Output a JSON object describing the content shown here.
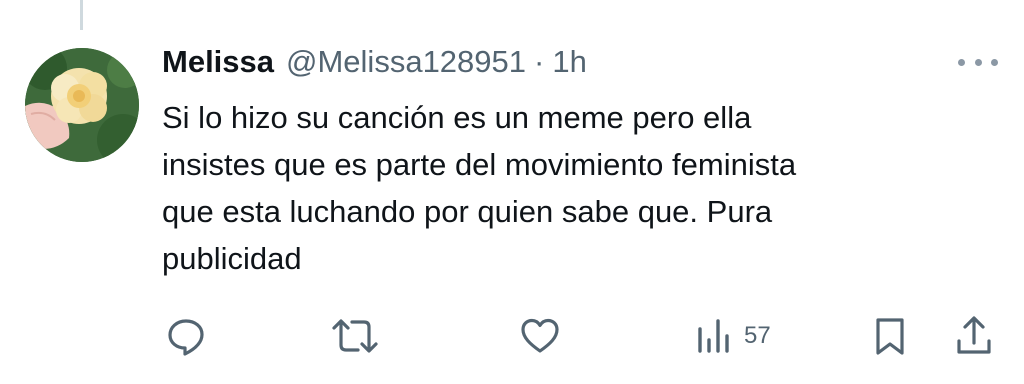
{
  "tweet": {
    "display_name": "Melissa",
    "handle": "@Melissa128951",
    "separator": "·",
    "time": "1h",
    "text_lines": [
      "Si lo hizo su canción es un meme pero ella",
      "insistes que es parte del movimiento feminista",
      "que esta luchando por quien sabe que. Pura",
      "publicidad"
    ]
  },
  "actions": {
    "reply_icon": "reply-icon",
    "retweet_icon": "retweet-icon",
    "like_icon": "heart-icon",
    "views_icon": "views-bar-chart-icon",
    "views_count": "57",
    "bookmark_icon": "bookmark-icon",
    "share_icon": "share-icon"
  },
  "colors": {
    "text": "#0f1419",
    "secondary": "#536471",
    "icon": "#536471",
    "thread_line": "#cfd9de"
  }
}
